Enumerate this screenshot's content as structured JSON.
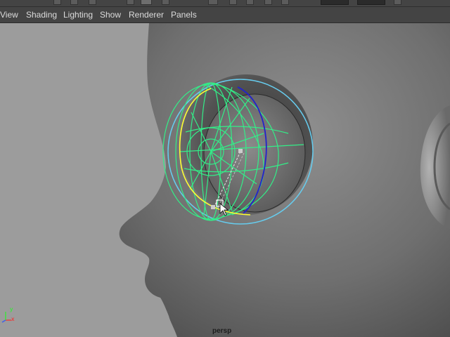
{
  "menubar": {
    "items": [
      {
        "id": "view",
        "label": "View"
      },
      {
        "id": "shading",
        "label": "Shading"
      },
      {
        "id": "lighting",
        "label": "Lighting"
      },
      {
        "id": "show",
        "label": "Show"
      },
      {
        "id": "renderer",
        "label": "Renderer"
      },
      {
        "id": "panels",
        "label": "Panels"
      }
    ]
  },
  "viewport": {
    "camera_label": "persp",
    "axis_x_label": "x",
    "axis_y_label": "y",
    "background_color": "#9c9c9c",
    "eye_wireframe_color": "#33ee88",
    "selection_ring_color": "#66ccee",
    "highlight_curve_color": "#ffff33",
    "pupil_curve_color": "#2222cc",
    "cursor_icon": "arrow-pointer-icon"
  }
}
